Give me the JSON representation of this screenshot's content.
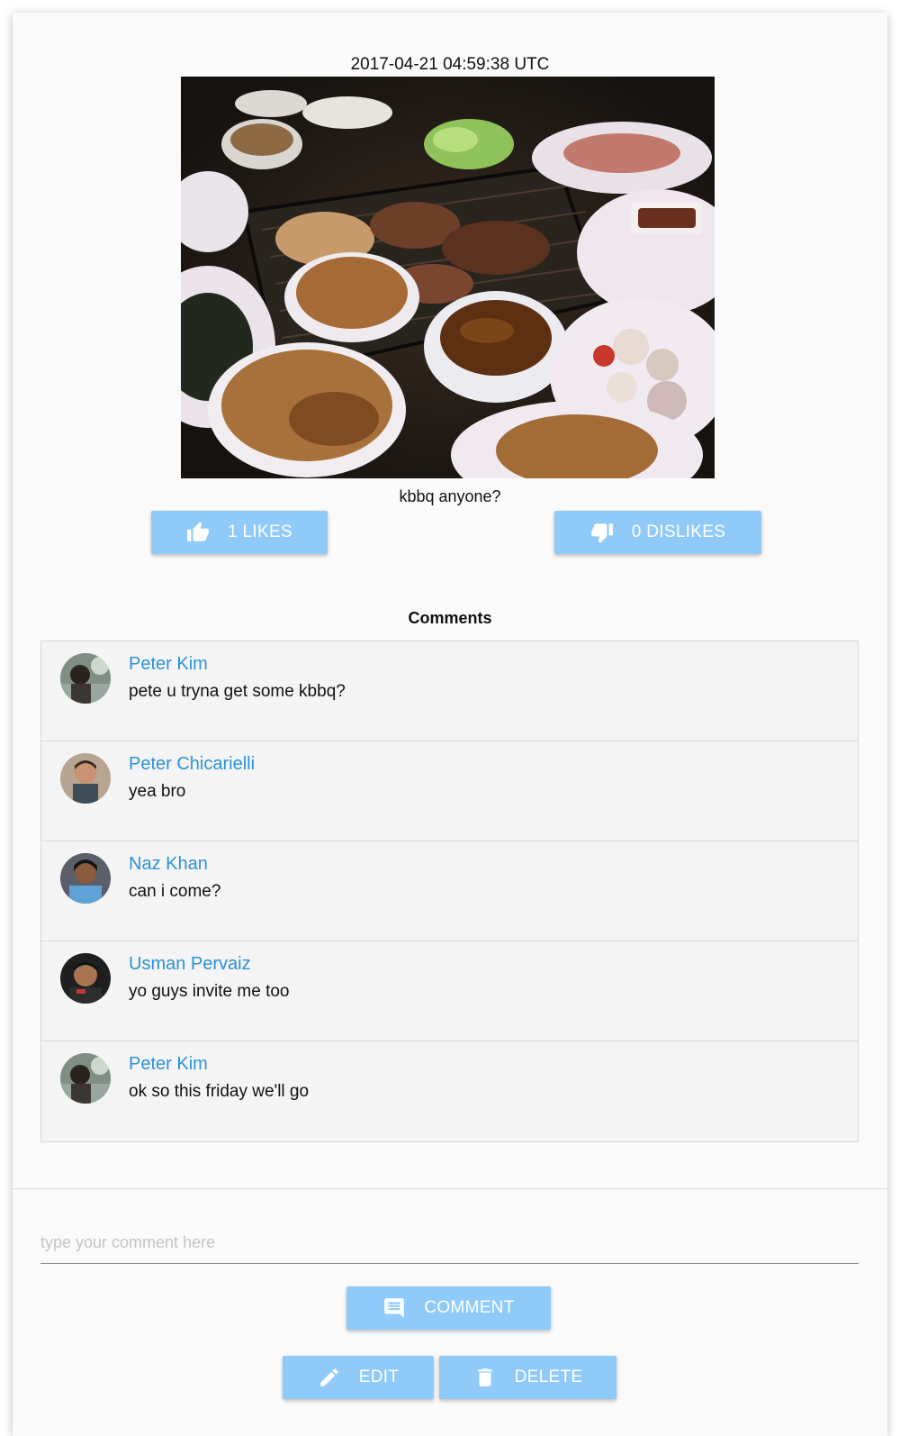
{
  "post": {
    "timestamp": "2017-04-21 04:59:38 UTC",
    "caption": "kbbq anyone?",
    "likes_label": "1 LIKES",
    "dislikes_label": "0 DISLIKES",
    "likes_icon": "thumb-up-icon",
    "dislikes_icon": "thumb-down-icon"
  },
  "comments_section": {
    "heading": "Comments",
    "items": [
      {
        "author": "Peter Kim",
        "text": "pete u tryna get some kbbq?"
      },
      {
        "author": "Peter Chicarielli",
        "text": "yea bro"
      },
      {
        "author": "Naz Khan",
        "text": "can i come?"
      },
      {
        "author": "Usman Pervaiz",
        "text": "yo guys invite me too"
      },
      {
        "author": "Peter Kim",
        "text": "ok so this friday we'll go"
      }
    ]
  },
  "composer": {
    "placeholder": "type your comment here",
    "value": "",
    "comment_label": "COMMENT",
    "comment_icon": "comment-icon",
    "edit_label": "EDIT",
    "edit_icon": "pencil-icon",
    "delete_label": "DELETE",
    "delete_icon": "trash-icon"
  },
  "colors": {
    "button": "#90caf9",
    "author_link": "#2b92d6",
    "card_background": "#fafafa"
  }
}
